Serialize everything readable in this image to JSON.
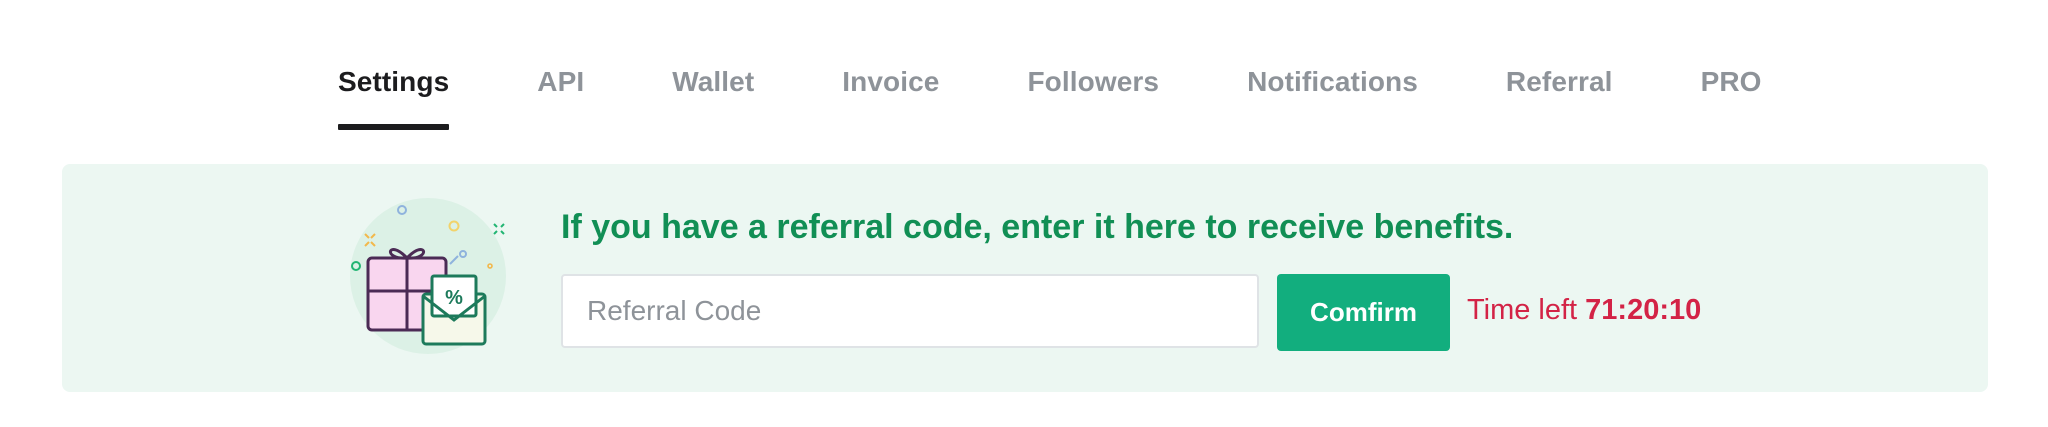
{
  "nav": {
    "tabs": [
      {
        "label": "Settings",
        "active": true
      },
      {
        "label": "API",
        "active": false
      },
      {
        "label": "Wallet",
        "active": false
      },
      {
        "label": "Invoice",
        "active": false
      },
      {
        "label": "Followers",
        "active": false
      },
      {
        "label": "Notifications",
        "active": false
      },
      {
        "label": "Referral",
        "active": false
      },
      {
        "label": "PRO",
        "active": false
      }
    ]
  },
  "referral": {
    "headline": "If you have a referral code, enter it here to receive benefits.",
    "input_placeholder": "Referral Code",
    "input_value": "",
    "confirm_label": "Comfirm",
    "timer_label": "Time left",
    "timer_value": "71:20:10",
    "illustration_icon": "gift-envelope-icon"
  },
  "colors": {
    "active_tab": "#1c1c1e",
    "inactive_tab": "#8e9399",
    "banner_bg": "#ecf7f2",
    "headline": "#118f55",
    "button": "#12ae7e",
    "timer": "#d32346"
  }
}
